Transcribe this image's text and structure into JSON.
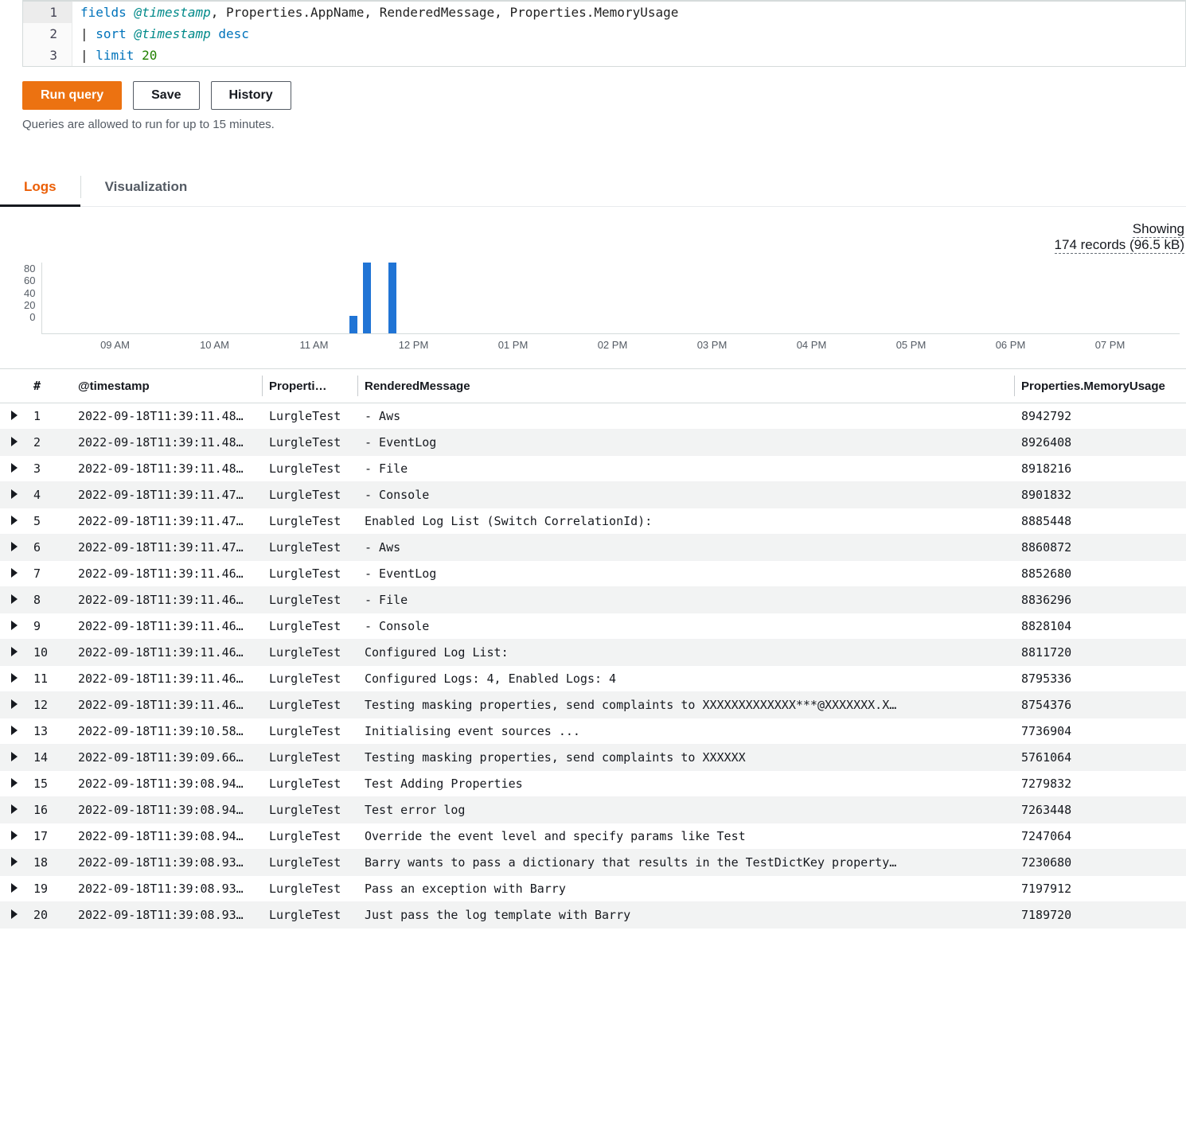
{
  "editor": {
    "lines": [
      {
        "num": "1",
        "html": "<span class='kw'>fields</span> <span class='id'>@timestamp</span><span class='plain'>, Properties.AppName, RenderedMessage, Properties.MemoryUsage</span>"
      },
      {
        "num": "2",
        "html": "<span class='plain'>| </span><span class='kw'>sort</span> <span class='id'>@timestamp</span> <span class='kw'>desc</span>"
      },
      {
        "num": "3",
        "html": "<span class='plain'>| </span><span class='kw'>limit</span> <span class='num'>20</span>"
      }
    ]
  },
  "toolbar": {
    "run": "Run query",
    "save": "Save",
    "history": "History"
  },
  "note": "Queries are allowed to run for up to 15 minutes.",
  "tabs": {
    "logs": "Logs",
    "viz": "Visualization"
  },
  "summary": {
    "label": "Showing",
    "records": "174 records (96.5 kB)"
  },
  "chart_data": {
    "type": "bar",
    "ylim": [
      0,
      80
    ],
    "yticks": [
      "80",
      "60",
      "40",
      "20",
      "0"
    ],
    "xticks": [
      "09 AM",
      "10 AM",
      "11 AM",
      "12 PM",
      "01 PM",
      "02 PM",
      "03 PM",
      "04 PM",
      "05 PM",
      "06 PM",
      "07 PM"
    ],
    "bars": [
      {
        "left_pct": 27.0,
        "height_pct": 25
      },
      {
        "left_pct": 28.2,
        "height_pct": 100
      },
      {
        "left_pct": 30.4,
        "height_pct": 100
      }
    ]
  },
  "columns": {
    "idx": "#",
    "ts": "@timestamp",
    "app": "Properti…",
    "msg": "RenderedMessage",
    "mem": "Properties.MemoryUsage"
  },
  "rows": [
    {
      "n": "1",
      "ts": "2022-09-18T11:39:11.48…",
      "app": "LurgleTest",
      "msg": " - Aws",
      "mem": "8942792"
    },
    {
      "n": "2",
      "ts": "2022-09-18T11:39:11.48…",
      "app": "LurgleTest",
      "msg": " - EventLog",
      "mem": "8926408"
    },
    {
      "n": "3",
      "ts": "2022-09-18T11:39:11.48…",
      "app": "LurgleTest",
      "msg": " - File",
      "mem": "8918216"
    },
    {
      "n": "4",
      "ts": "2022-09-18T11:39:11.47…",
      "app": "LurgleTest",
      "msg": " - Console",
      "mem": "8901832"
    },
    {
      "n": "5",
      "ts": "2022-09-18T11:39:11.47…",
      "app": "LurgleTest",
      "msg": "Enabled Log List (Switch CorrelationId):",
      "mem": "8885448"
    },
    {
      "n": "6",
      "ts": "2022-09-18T11:39:11.47…",
      "app": "LurgleTest",
      "msg": " - Aws",
      "mem": "8860872"
    },
    {
      "n": "7",
      "ts": "2022-09-18T11:39:11.46…",
      "app": "LurgleTest",
      "msg": " - EventLog",
      "mem": "8852680"
    },
    {
      "n": "8",
      "ts": "2022-09-18T11:39:11.46…",
      "app": "LurgleTest",
      "msg": " - File",
      "mem": "8836296"
    },
    {
      "n": "9",
      "ts": "2022-09-18T11:39:11.46…",
      "app": "LurgleTest",
      "msg": " - Console",
      "mem": "8828104"
    },
    {
      "n": "10",
      "ts": "2022-09-18T11:39:11.46…",
      "app": "LurgleTest",
      "msg": "Configured Log List:",
      "mem": "8811720"
    },
    {
      "n": "11",
      "ts": "2022-09-18T11:39:11.46…",
      "app": "LurgleTest",
      "msg": "Configured Logs: 4, Enabled Logs: 4",
      "mem": "8795336"
    },
    {
      "n": "12",
      "ts": "2022-09-18T11:39:11.46…",
      "app": "LurgleTest",
      "msg": "Testing masking properties, send complaints to XXXXXXXXXXXXX***@XXXXXXX.X…",
      "mem": "8754376"
    },
    {
      "n": "13",
      "ts": "2022-09-18T11:39:10.58…",
      "app": "LurgleTest",
      "msg": "Initialising event sources ...",
      "mem": "7736904"
    },
    {
      "n": "14",
      "ts": "2022-09-18T11:39:09.66…",
      "app": "LurgleTest",
      "msg": "Testing masking properties, send complaints to XXXXXX",
      "mem": "5761064"
    },
    {
      "n": "15",
      "ts": "2022-09-18T11:39:08.94…",
      "app": "LurgleTest",
      "msg": "Test Adding Properties",
      "mem": "7279832"
    },
    {
      "n": "16",
      "ts": "2022-09-18T11:39:08.94…",
      "app": "LurgleTest",
      "msg": "Test error log",
      "mem": "7263448"
    },
    {
      "n": "17",
      "ts": "2022-09-18T11:39:08.94…",
      "app": "LurgleTest",
      "msg": "Override the event level and specify params like Test",
      "mem": "7247064"
    },
    {
      "n": "18",
      "ts": "2022-09-18T11:39:08.93…",
      "app": "LurgleTest",
      "msg": "Barry wants to pass a dictionary that results in the TestDictKey property…",
      "mem": "7230680"
    },
    {
      "n": "19",
      "ts": "2022-09-18T11:39:08.93…",
      "app": "LurgleTest",
      "msg": "Pass an exception with Barry",
      "mem": "7197912"
    },
    {
      "n": "20",
      "ts": "2022-09-18T11:39:08.93…",
      "app": "LurgleTest",
      "msg": "Just pass the log template with Barry",
      "mem": "7189720"
    }
  ]
}
